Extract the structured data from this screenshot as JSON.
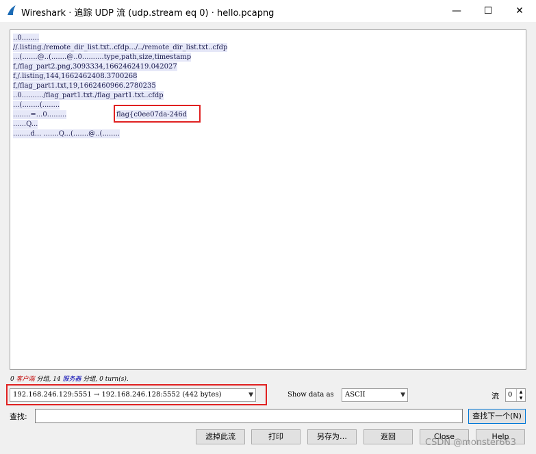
{
  "window": {
    "title": "Wireshark · 追踪 UDP 流 (udp.stream eq 0) · hello.pcapng",
    "controls": {
      "minimize": "—",
      "maximize": "☐",
      "close": "✕"
    }
  },
  "stream_lines": [
    "..0........",
    "//.listing./remote_dir_list.txt..cfdp.../../remote_dir_list.txt..cfdp",
    "...(.......@..(.......@..0..........type,path,size,timestamp",
    "f,/flag_part2.png,3093334,1662462419.042027",
    "f,/.listing,144,1662462408.3700268",
    "f,/flag_part1.txt,19,1662460966.2780235",
    "..0........../flag_part1.txt./flag_part1.txt..cfdp",
    "...(........(........",
    "........=...0.........",
    "......Q...",
    "........d... .......Q...(.......@..(........"
  ],
  "flag_text": "flag{c0ee07da-246d",
  "stats": {
    "prefix": "0 ",
    "client": "客户端",
    "mid1": " 分组, 14 ",
    "server": "服务器",
    "mid2": " 分组, 0 turn(s)."
  },
  "conversation": {
    "value": "192.168.246.129:5551 → 192.168.246.128:5552 (442 bytes)"
  },
  "show_data_as": {
    "label": "Show data as",
    "value": "ASCII"
  },
  "stream_index": {
    "label": "流",
    "value": "0"
  },
  "find": {
    "label": "查找:",
    "value": "",
    "next_button": "查找下一个(N)"
  },
  "buttons": {
    "filter_out": "滤掉此流",
    "print": "打印",
    "save_as": "另存为…",
    "back": "返回",
    "close": "Close",
    "help": "Help"
  },
  "watermark": "CSDN @monster663",
  "colors": {
    "highlight_red": "#e02020",
    "stream_bg": "#e6e8f8",
    "stream_text": "#1a1a4c",
    "client_color": "#c00000",
    "server_color": "#0000b0"
  }
}
